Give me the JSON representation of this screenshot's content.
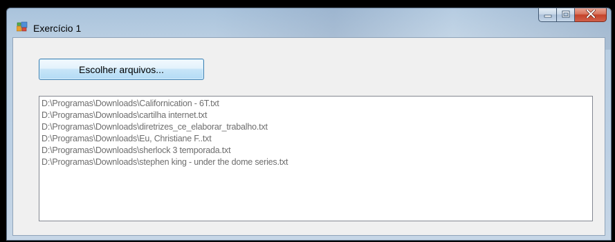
{
  "window": {
    "title": "Exercício 1",
    "icon": "windows-forms-app-icon"
  },
  "caption": {
    "minimize_icon": "minimize-icon",
    "maximize_icon": "maximize-icon",
    "close_icon": "close-icon",
    "close_color": "#c4432a"
  },
  "main": {
    "choose_button_label": "Escolher arquivos...",
    "files": [
      "D:\\Programas\\Downloads\\Californication - 6T.txt",
      "D:\\Programas\\Downloads\\cartilha internet.txt",
      "D:\\Programas\\Downloads\\diretrizes_ce_elaborar_trabalho.txt",
      "D:\\Programas\\Downloads\\Eu, Christiane F..txt",
      "D:\\Programas\\Downloads\\sherlock 3 temporada.txt",
      "D:\\Programas\\Downloads\\stephen king - under the dome series.txt"
    ]
  }
}
